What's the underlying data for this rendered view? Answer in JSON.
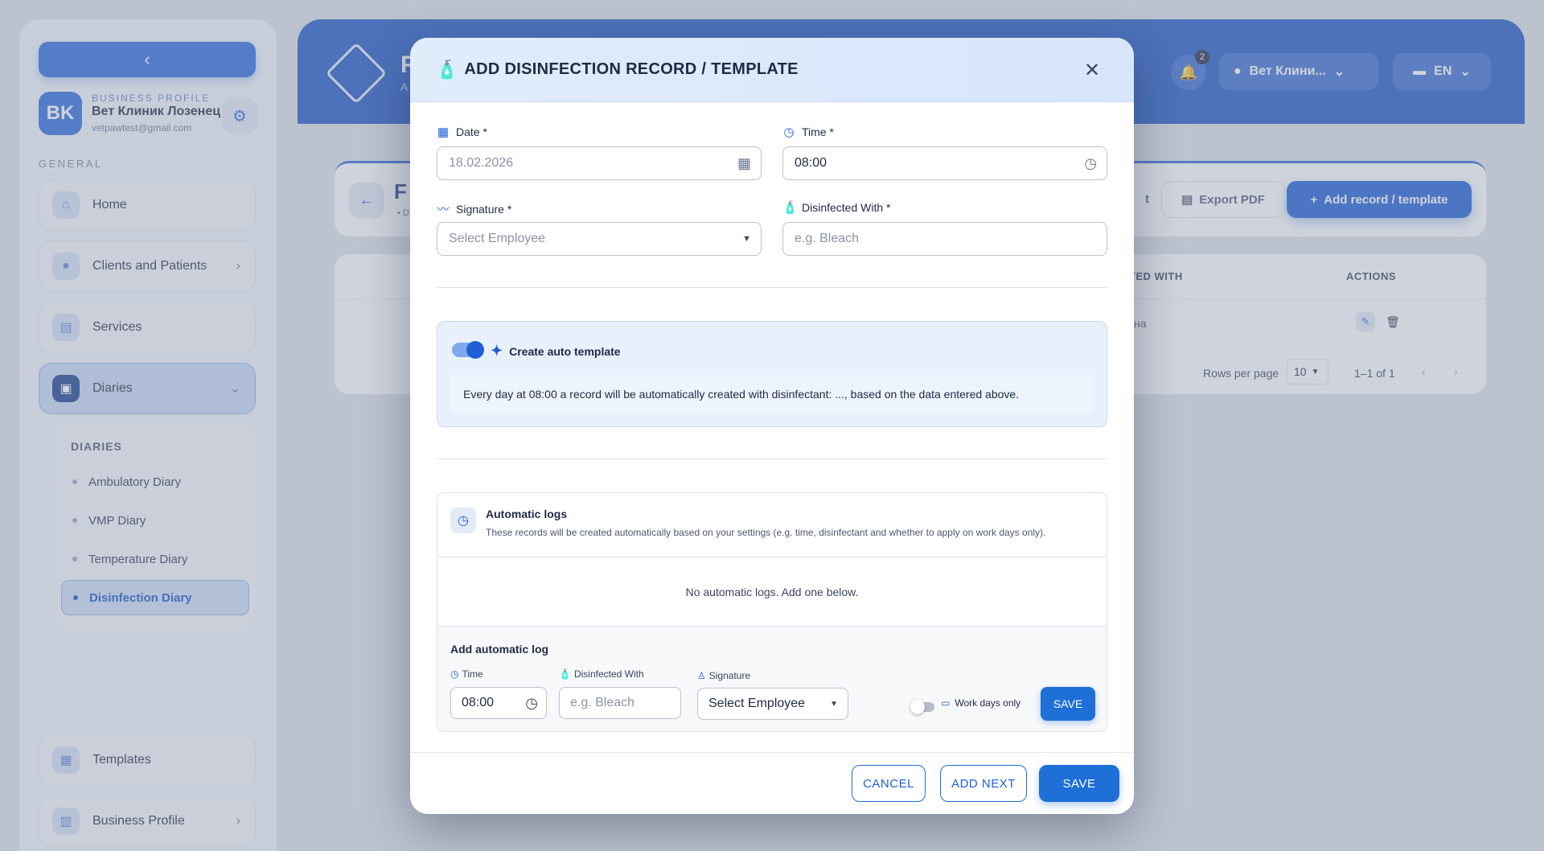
{
  "sidebar": {
    "collapse_glyph": "‹",
    "profile": {
      "initials": "BK",
      "tag": "BUSINESS PROFILE",
      "name": "Вет Клиник Лозенец",
      "email": "vetpawtest@gmail.com"
    },
    "group_label": "GENERAL",
    "items": [
      {
        "label": "Home",
        "icon": "home-icon"
      },
      {
        "label": "Clients and Patients",
        "icon": "paw-icon"
      },
      {
        "label": "Services",
        "icon": "services-icon"
      },
      {
        "label": "Diaries",
        "icon": "book-icon"
      }
    ],
    "diaries": {
      "title": "DIARIES",
      "items": [
        "Ambulatory Diary",
        "VMP Diary",
        "Temperature Diary",
        "Disinfection Diary"
      ]
    },
    "bottom_items": [
      {
        "label": "Templates",
        "icon": "template-icon"
      },
      {
        "label": "Business Profile",
        "icon": "business-icon"
      }
    ]
  },
  "topbar": {
    "title": "F",
    "subtitle": "A",
    "notifications_count": "2",
    "location": "Вет Клини...",
    "language": "EN"
  },
  "page": {
    "title": "F",
    "breadcrumb": "• D",
    "export_partial": "t",
    "export_pdf": "Export PDF",
    "add_record": "Add record / template",
    "table": {
      "headers": [
        "CTED WITH",
        "ACTIONS"
      ],
      "row_value": "лина",
      "rows_per_page_label": "Rows per page",
      "rows_per_page": "10",
      "range": "1–1 of 1"
    }
  },
  "modal": {
    "title": "ADD DISINFECTION RECORD / TEMPLATE",
    "date_label": "Date *",
    "date_value": "18.02.2026",
    "time_label": "Time *",
    "time_value": "08:00",
    "signature_label": "Signature *",
    "signature_placeholder": "Select Employee",
    "disinfected_label": "Disinfected With *",
    "disinfected_placeholder": "e.g. Bleach",
    "auto_template": {
      "label": "Create auto template",
      "enabled": true,
      "description": "Every day at 08:00 a record will be automatically created with disinfectant: ..., based on the data entered above."
    },
    "automatic_logs": {
      "title": "Automatic logs",
      "subtitle": "These records will be created automatically based on your settings (e.g. time, disinfectant and whether to apply on work days only).",
      "empty": "No automatic logs. Add one below.",
      "add_title": "Add automatic log",
      "time_label": "Time",
      "time_value": "08:00",
      "disinfected_label": "Disinfected With",
      "disinfected_placeholder": "e.g. Bleach",
      "signature_label": "Signature",
      "signature_value": "Select Employee",
      "work_days_label": "Work days only",
      "work_days_enabled": false,
      "save": "SAVE"
    },
    "footer": {
      "cancel": "CANCEL",
      "add_next": "ADD NEXT",
      "save": "SAVE"
    }
  },
  "colors": {
    "primary": "#1e6fd6",
    "header_blue": "#1f57c6",
    "modal_header_bg": "#e1ecfb"
  }
}
